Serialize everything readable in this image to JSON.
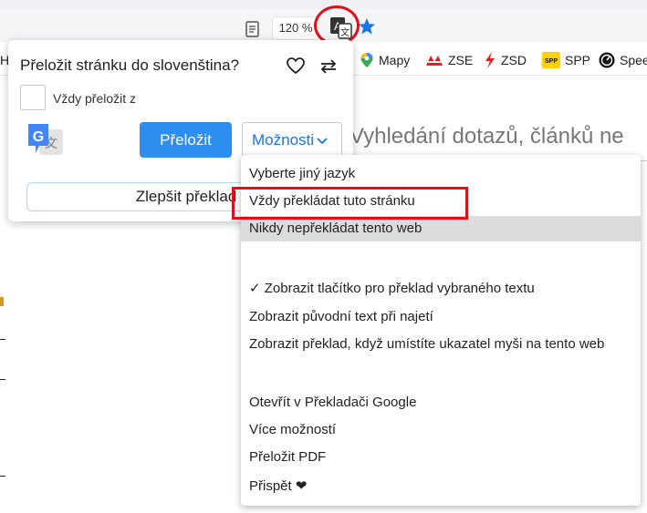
{
  "toolbar": {
    "zoom": "120 %"
  },
  "bookmarks": [
    {
      "label": "Mapy",
      "icon": "map-pin-icon"
    },
    {
      "label": "ZSE",
      "icon": "zse-logo-icon"
    },
    {
      "label": "ZSD",
      "icon": "zsd-lightning-icon"
    },
    {
      "label": "SPP",
      "icon": "spp-logo-icon"
    },
    {
      "label": "Spee",
      "icon": "speedometer-icon"
    }
  ],
  "bookmark_fragment": "H",
  "page": {
    "search_text": "Vyhledání dotazů, článků ne"
  },
  "popup": {
    "title": "Přeložit stránku do slovenština?",
    "always_translate_label": "Vždy přeložit z",
    "translate_button": "Přeložit",
    "options_button": "Možnosti",
    "improve_button": "Zlepšit překlad"
  },
  "menu": {
    "items": [
      "Vyberte jiný jazyk",
      "Vždy překládat tuto stránku",
      "Nikdy nepřekládat tento web",
      "✓ Zobrazit tlačítko pro překlad vybraného textu",
      "Zobrazit původní text při najetí",
      "Zobrazit překlad, když umístíte ukazatel myši na tento web",
      "Otevřít v Překladači Google",
      "Více možností",
      "Přeložit PDF",
      "Přispět ❤"
    ]
  },
  "colors": {
    "accent": "#2d8ef0",
    "highlight": "#e0101a",
    "link": "#1a73e8"
  }
}
